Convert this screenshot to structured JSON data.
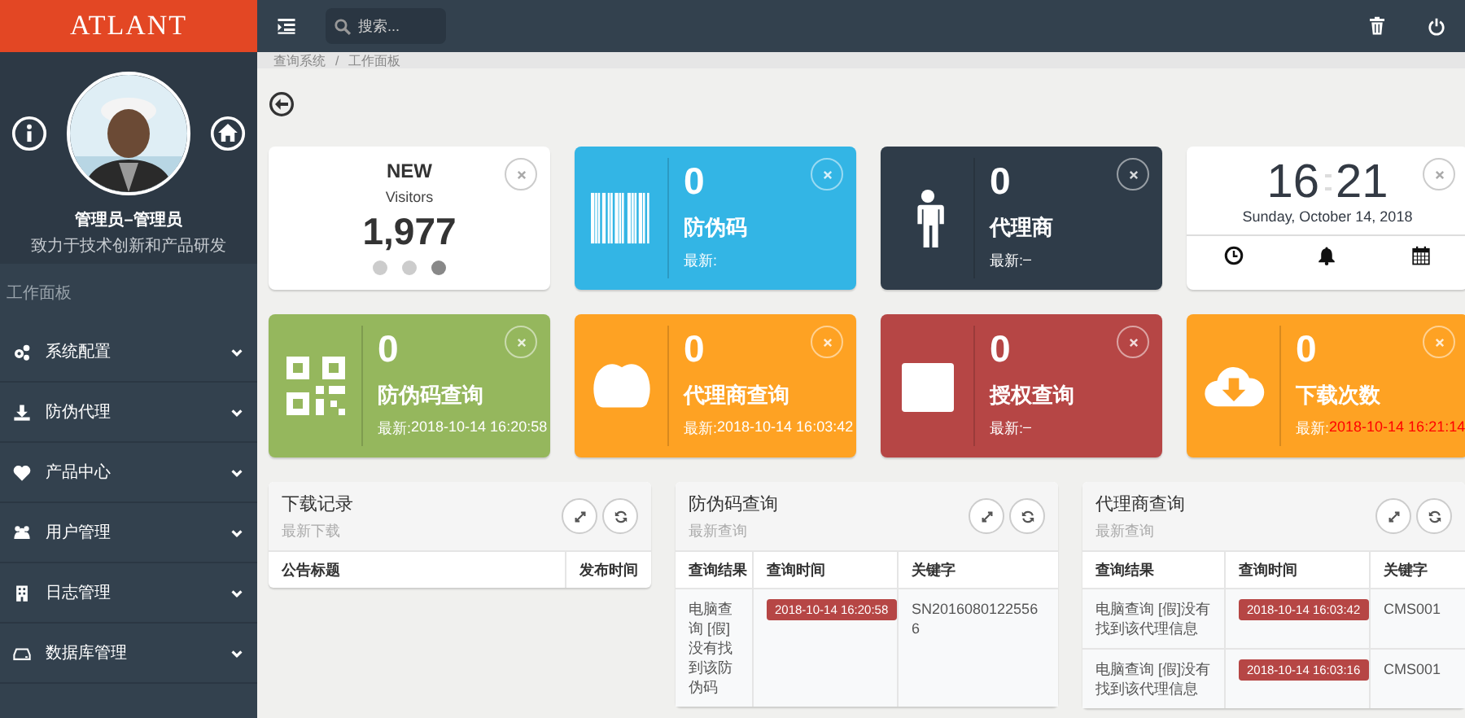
{
  "logo": "ATLANT",
  "search": {
    "placeholder": "搜索..."
  },
  "breadcrumb": {
    "items": [
      "查询系统",
      "工作面板"
    ],
    "separator": "/"
  },
  "profile": {
    "name": "管理员–管理员",
    "motto": "致力于技术创新和产品研发"
  },
  "sidebar": {
    "section": "工作面板",
    "items": [
      {
        "label": "系统配置",
        "expanded": false
      },
      {
        "label": "防伪代理",
        "expanded": false
      },
      {
        "label": "产品中心",
        "expanded": false
      },
      {
        "label": "用户管理",
        "expanded": false
      },
      {
        "label": "日志管理",
        "expanded": false
      },
      {
        "label": "数据库管理",
        "expanded": false
      }
    ]
  },
  "tiles": [
    {
      "kind": "visitors",
      "title": "NEW",
      "subtitle": "Visitors",
      "count": "1,977",
      "dots": [
        {
          "selected": false
        },
        {
          "selected": false
        },
        {
          "selected": true
        }
      ]
    },
    {
      "kind": "stat",
      "color": "#33b5e5",
      "count": "0",
      "label": "防伪码",
      "latest_label": "最新:"
    },
    {
      "kind": "stat",
      "color": "#2f3c49",
      "count": "0",
      "label": "代理商",
      "latest_label": "最新:",
      "latest_value": "–"
    },
    {
      "kind": "clock",
      "hours": "16",
      "minutes": "21",
      "date": "Sunday, October 14, 2018"
    },
    {
      "kind": "stat",
      "color": "#95b75d",
      "count": "0",
      "label": "防伪码查询",
      "latest_label": "最新:",
      "latest_value": "2018-10-14 16:20:58"
    },
    {
      "kind": "stat",
      "color": "#fea223",
      "count": "0",
      "label": "代理商查询",
      "latest_label": "最新:",
      "latest_value": "2018-10-14 16:03:42"
    },
    {
      "kind": "stat",
      "color": "#b64645",
      "count": "0",
      "label": "授权查询",
      "latest_label": "最新:",
      "latest_value": "–"
    },
    {
      "kind": "stat",
      "color": "#fea223",
      "count": "0",
      "label": "下载次数",
      "latest_label": "最新:",
      "latest_value": "2018-10-14 16:21:14",
      "highlight": true
    }
  ],
  "panels": [
    {
      "title": "下载记录",
      "subtitle": "最新下载",
      "columns": [
        "公告标题",
        "发布时间"
      ]
    },
    {
      "title": "防伪码查询",
      "subtitle": "最新查询",
      "columns": [
        "查询结果",
        "查询时间",
        "关键字"
      ],
      "rows": [
        {
          "result": "电脑查询 [假]没有找到该防伪码",
          "time": "2018-10-14 16:20:58",
          "keyword": "SN20160801225566"
        }
      ]
    },
    {
      "title": "代理商查询",
      "subtitle": "最新查询",
      "columns": [
        "查询结果",
        "查询时间",
        "关键字"
      ],
      "rows": [
        {
          "result": "电脑查询 [假]没有找到该代理信息",
          "time": "2018-10-14 16:03:42",
          "keyword": "CMS001"
        },
        {
          "result": "电脑查询 [假]没有找到该代理信息",
          "time": "2018-10-14 16:03:16",
          "keyword": "CMS001"
        }
      ]
    }
  ]
}
